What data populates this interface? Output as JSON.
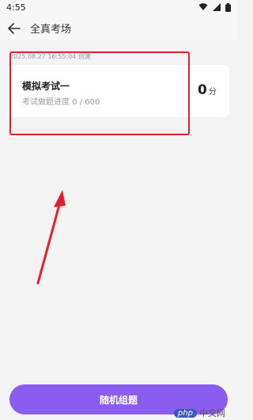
{
  "status_bar": {
    "time": "4:55"
  },
  "header": {
    "title": "全真考场"
  },
  "exam": {
    "created": "2025.08.27 16:55:04 创建",
    "name": "模拟考试一",
    "progress": "考试做题进度 0 / 600",
    "score_value": "0",
    "score_unit": "分"
  },
  "footer": {
    "random_label": "随机组题"
  },
  "watermark": {
    "brand": "php",
    "site": "中文网"
  },
  "colors": {
    "accent": "#8a5cf0",
    "annotation": "#e5202e"
  },
  "icons": {
    "back": "arrow-left-icon",
    "wifi": "wifi-icon",
    "signal": "signal-icon",
    "battery": "battery-icon"
  }
}
